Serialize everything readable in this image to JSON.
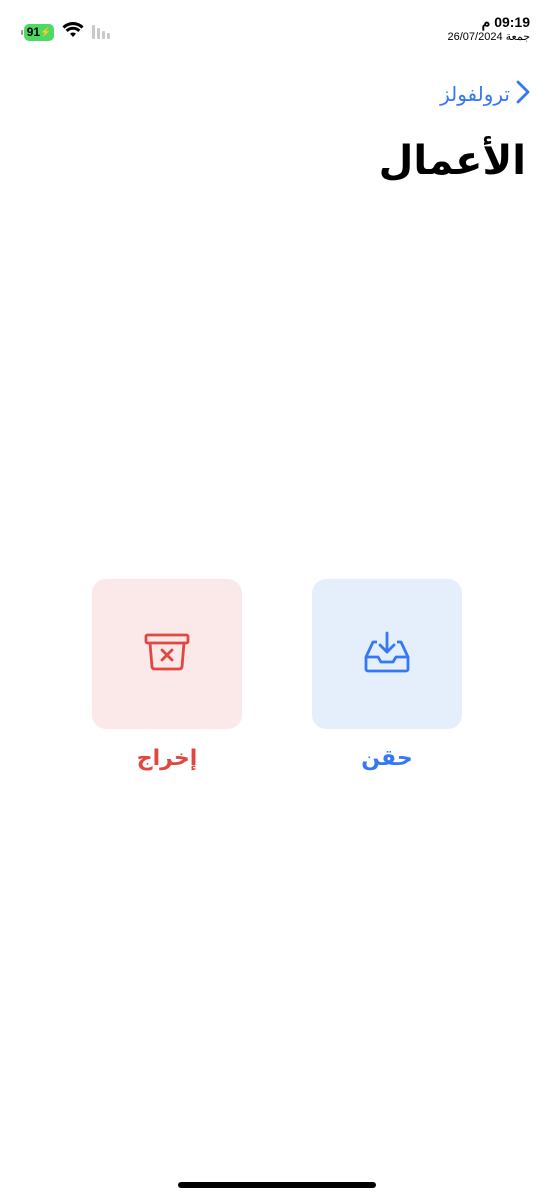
{
  "status_bar": {
    "battery_level": "91",
    "time": "09:19 م",
    "date": "جمعة 26/07/2024",
    "icons": [
      "battery-charging-icon",
      "wifi-icon",
      "cellular-signal-icon"
    ]
  },
  "nav": {
    "back_label": "ترولفولز"
  },
  "page": {
    "title": "الأعمال"
  },
  "actions": [
    {
      "label": "حقن",
      "icon": "tray-download-icon",
      "color": "#3478f6",
      "background": "#e5effb"
    },
    {
      "label": "إخراج",
      "icon": "basket-x-icon",
      "color": "#e0473f",
      "background": "#fbe9e9"
    }
  ],
  "colors": {
    "accent": "#3478f6",
    "destructive": "#e0473f",
    "battery": "#4cd964"
  }
}
